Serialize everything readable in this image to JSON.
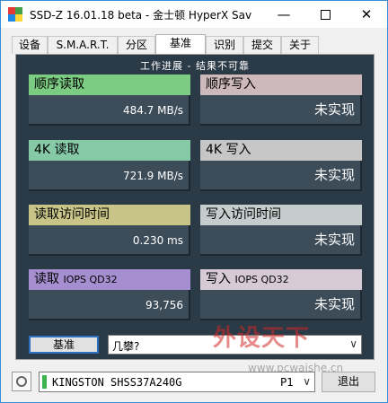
{
  "window": {
    "title": "SSD-Z 16.01.18 beta - 金士顿 HyperX Sav",
    "minimize_glyph": "—",
    "close_glyph": "✕"
  },
  "tabs": [
    {
      "label": "设备"
    },
    {
      "label": "S.M.A.R.T."
    },
    {
      "label": "分区"
    },
    {
      "label": "基准",
      "active": true
    },
    {
      "label": "识别"
    },
    {
      "label": "提交"
    },
    {
      "label": "关于"
    }
  ],
  "panel": {
    "header": "工作进展 - 结果不可靠"
  },
  "results": {
    "seq_read": {
      "label": "顺序读取",
      "value": "484.7 MB/s"
    },
    "seq_write": {
      "label": "顺序写入",
      "value": "未实现"
    },
    "k4_read": {
      "label": "4K 读取",
      "value": "721.9 MB/s"
    },
    "k4_write": {
      "label": "4K 写入",
      "value": "未实现"
    },
    "acc_read": {
      "label": "读取访问时间",
      "value": "0.230 ms"
    },
    "acc_write": {
      "label": "写入访问时间",
      "value": "未实现"
    },
    "iops_read": {
      "label_main": "读取",
      "label_small": "IOPS QD32",
      "value": "93,756"
    },
    "iops_write": {
      "label_main": "写入",
      "label_small": "IOPS QD32",
      "value": "未实现"
    }
  },
  "controls": {
    "benchmark_button": "基准",
    "size_select_value": "几攀?",
    "dropdown_glyph": "∨"
  },
  "drive": {
    "name": "KINGSTON SHSS37A240G",
    "port": "P1",
    "exit_button": "退出"
  },
  "watermark": {
    "logo": "外设天下",
    "url": "www.pcwaishe.cn"
  },
  "colors": {
    "panel_bg": "#2b3a47",
    "seq_read": "#7ccb82",
    "k4_read": "#86c9a6",
    "acc_read": "#c8c487",
    "iops_read": "#a68fd0",
    "accent": "#2c6fbf"
  }
}
